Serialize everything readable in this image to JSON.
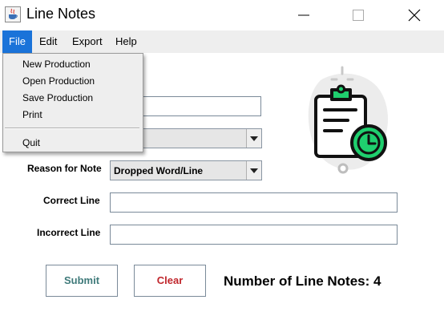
{
  "window": {
    "title": "Line Notes"
  },
  "menubar": {
    "items": [
      "File",
      "Edit",
      "Export",
      "Help"
    ]
  },
  "file_menu": {
    "items": [
      "New Production",
      "Open Production",
      "Save Production",
      "Print",
      "Quit"
    ]
  },
  "form": {
    "reason_label": "Reason for Note",
    "reason_value": "Dropped Word/Line",
    "correct_label": "Correct Line",
    "correct_value": "",
    "incorrect_label": "Incorrect Line",
    "incorrect_value": ""
  },
  "buttons": {
    "submit": "Submit",
    "clear": "Clear"
  },
  "status": {
    "count_text": "Number of Line Notes: 4"
  },
  "colors": {
    "accent": "#1a73d9",
    "submit_text": "#3f7a7a",
    "clear_text": "#c0262c",
    "clock_green": "#1fcf6e"
  }
}
